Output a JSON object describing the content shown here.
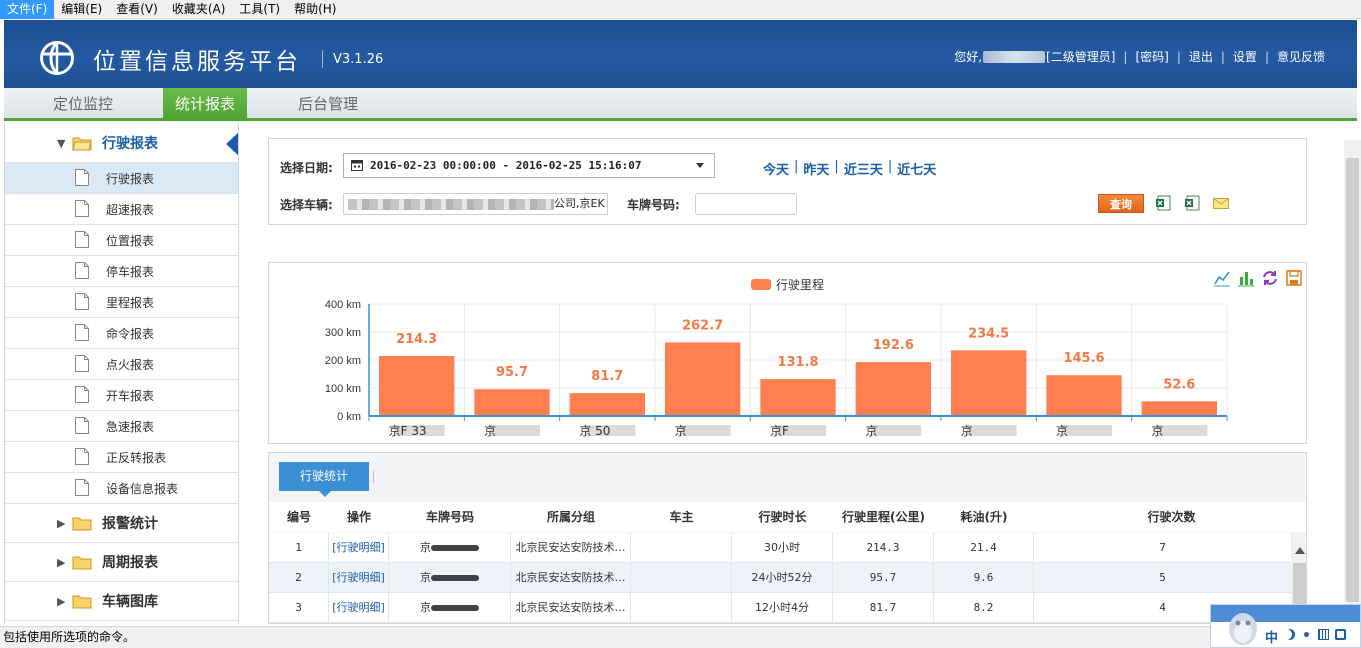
{
  "menubar": {
    "items": [
      "文件(F)",
      "编辑(E)",
      "查看(V)",
      "收藏夹(A)",
      "工具(T)",
      "帮助(H)"
    ]
  },
  "header": {
    "title": "位置信息服务平台",
    "version": "V3.1.26",
    "greeting": "您好,",
    "role": "[二级管理员]",
    "links": [
      "[密码]",
      "退出",
      "设置",
      "意见反馈"
    ]
  },
  "nav": {
    "tabs": [
      "定位监控",
      "统计报表",
      "后台管理"
    ],
    "active": 1
  },
  "sidebar": {
    "open_group": "行驶报表",
    "items": [
      "行驶报表",
      "超速报表",
      "位置报表",
      "停车报表",
      "里程报表",
      "命令报表",
      "点火报表",
      "开车报表",
      "急速报表",
      "正反转报表",
      "设备信息报表"
    ],
    "groups": [
      "报警统计",
      "周期报表",
      "车辆图库"
    ]
  },
  "filter": {
    "date_label": "选择日期:",
    "date_value": "2016-02-23 00:00:00 - 2016-02-25 15:16:07",
    "quick_links": [
      "今天",
      "昨天",
      "近三天",
      "近七天"
    ],
    "vehicle_label": "选择车辆:",
    "vehicle_value_tail": "公司,京EK",
    "plate_label": "车牌号码:",
    "plate_value": "",
    "query_button": "查询"
  },
  "chart_data": {
    "type": "bar",
    "title": "",
    "legend": "行驶里程",
    "legend_color": "#ff7f50",
    "categories": [
      "京F    33",
      "京",
      "京    50",
      "京",
      "京F",
      "京",
      "京",
      "京",
      "京"
    ],
    "values": [
      214.3,
      95.7,
      81.7,
      262.7,
      131.8,
      192.6,
      234.5,
      145.6,
      52.6
    ],
    "y_ticks": [
      "0 km",
      "100 km",
      "200 km",
      "300 km",
      "400 km"
    ],
    "ylim": [
      0,
      400
    ],
    "bar_color": "#ff7f50",
    "label_color": "#f47a45"
  },
  "table": {
    "tab_label": "行驶统计",
    "columns": [
      "编号",
      "操作",
      "车牌号码",
      "所属分组",
      "车主",
      "行驶时长",
      "行驶里程(公里)",
      "耗油(升)",
      "行驶次数"
    ],
    "rows": [
      {
        "no": "1",
        "op": "[行驶明细]",
        "plate": "京",
        "group": "北京民安达安防技术…",
        "owner": "",
        "duration": "30小时",
        "mileage": "214.3",
        "fuel": "21.4",
        "trips": "7"
      },
      {
        "no": "2",
        "op": "[行驶明细]",
        "plate": "京",
        "group": "北京民安达安防技术…",
        "owner": "",
        "duration": "24小时52分",
        "mileage": "95.7",
        "fuel": "9.6",
        "trips": "5"
      },
      {
        "no": "3",
        "op": "[行驶明细]",
        "plate": "京",
        "group": "北京民安达安防技术…",
        "owner": "",
        "duration": "12小时4分",
        "mileage": "81.7",
        "fuel": "8.2",
        "trips": "4"
      }
    ]
  },
  "status_bar": {
    "text": "包括使用所选项的命令。"
  },
  "ime": {
    "mode": "中"
  }
}
